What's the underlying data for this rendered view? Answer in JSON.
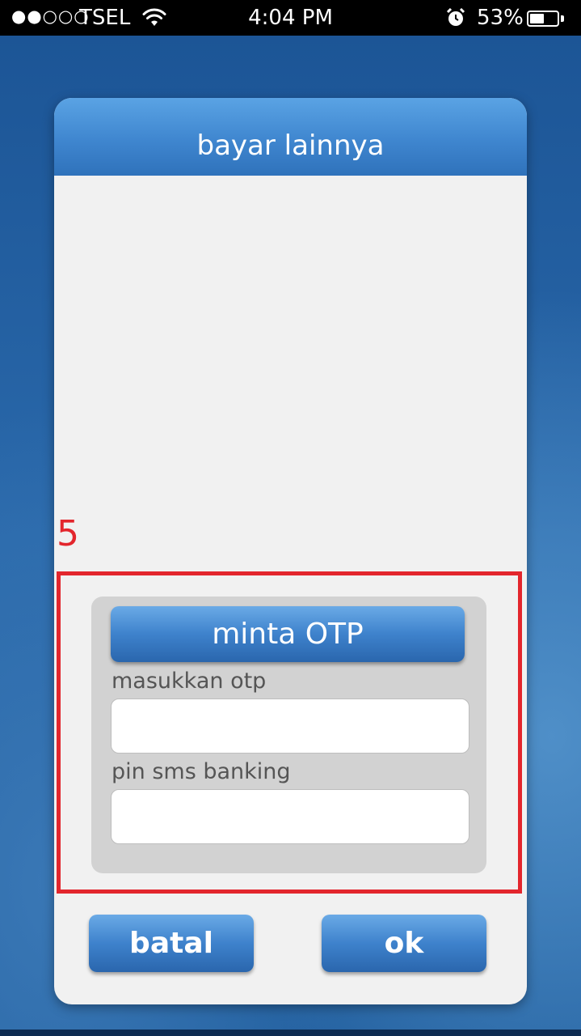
{
  "status_bar": {
    "signal": "●●○○○",
    "carrier": "TSEL",
    "time": "4:04 PM",
    "battery_percent": "53%",
    "battery_level": 0.53,
    "icons": [
      "wifi-icon",
      "alarm-icon",
      "battery-icon"
    ]
  },
  "dialog": {
    "title": "bayar lainnya"
  },
  "annotation": {
    "number": "5",
    "color": "#e3262d"
  },
  "otp_form": {
    "request_otp_label": "minta OTP",
    "otp_label": "masukkan otp",
    "otp_value": "",
    "pin_label": "pin sms banking",
    "pin_value": ""
  },
  "actions": {
    "cancel_label": "batal",
    "ok_label": "ok"
  },
  "colors": {
    "accent_blue": "#3e82cc",
    "dialog_bg": "#f1f1f1",
    "panel_bg": "#d2d2d2"
  }
}
